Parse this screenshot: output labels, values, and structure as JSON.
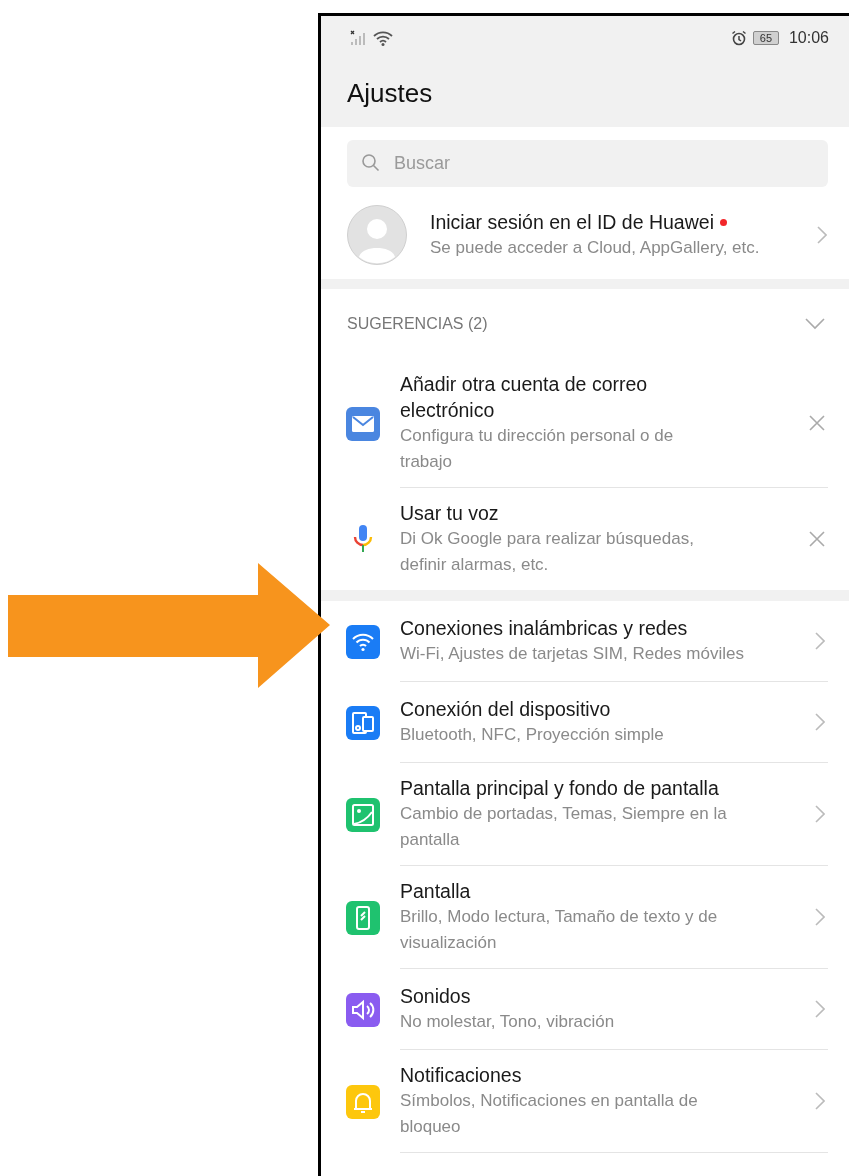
{
  "status_bar": {
    "battery": "65",
    "time": "10:06"
  },
  "header": {
    "title": "Ajustes"
  },
  "search": {
    "placeholder": "Buscar"
  },
  "account": {
    "title": "Iniciar sesión en el ID de Huawei",
    "subtitle": "Se puede acceder a Cloud, AppGallery, etc.",
    "unread": true
  },
  "suggestions": {
    "title": "SUGERENCIAS (2)",
    "expanded": true,
    "items": [
      {
        "title": "Añadir otra cuenta de correo electrónico",
        "subtitle": "Configura tu dirección personal o de trabajo"
      },
      {
        "title": "Usar tu voz",
        "subtitle": "Di Ok Google para realizar búsquedas, definir alarmas, etc."
      }
    ]
  },
  "settings": [
    {
      "title": "Conexiones inalámbricas y redes",
      "subtitle": "Wi-Fi, Ajustes de tarjetas SIM, Redes móviles",
      "color": "#1a7cf5"
    },
    {
      "title": "Conexión del dispositivo",
      "subtitle": "Bluetooth, NFC, Proyección simple",
      "color": "#1a7cf5"
    },
    {
      "title": "Pantalla principal y fondo de pantalla",
      "subtitle": "Cambio de portadas, Temas, Siempre en la pantalla",
      "color": "#1fc26f"
    },
    {
      "title": "Pantalla",
      "subtitle": "Brillo, Modo lectura, Tamaño de texto y de visualización",
      "color": "#1fc26f"
    },
    {
      "title": "Sonidos",
      "subtitle": "No molestar, Tono, vibración",
      "color": "#8a5cf0"
    },
    {
      "title": "Notificaciones",
      "subtitle": "Símbolos, Notificaciones en pantalla de bloqueo",
      "color": "#fdc70d"
    }
  ]
}
